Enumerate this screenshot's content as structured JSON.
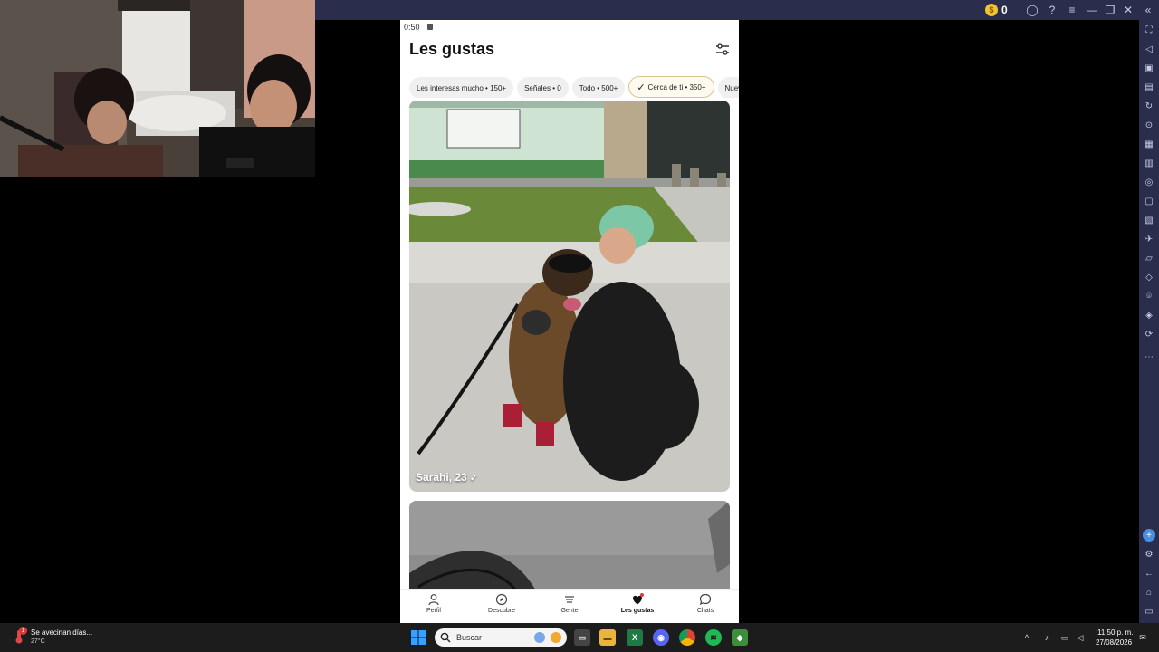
{
  "emulator": {
    "coin_count": "0"
  },
  "phone": {
    "status_time": "0:50",
    "page_title": "Les gustas",
    "chips": [
      {
        "label": "Les interesas mucho • 150+",
        "active": false
      },
      {
        "label": "Señales • 0",
        "active": false
      },
      {
        "label": "Todo • 500+",
        "active": false
      },
      {
        "label": "Cerca de ti • 350+",
        "active": true
      },
      {
        "label": "Nuevos •",
        "active": false
      }
    ],
    "card1": {
      "name": "Sarahi, 23"
    },
    "bottom_nav": [
      {
        "label": "Perfil",
        "icon": "person-icon"
      },
      {
        "label": "Descubre",
        "icon": "compass-icon"
      },
      {
        "label": "Gente",
        "icon": "menu-icon"
      },
      {
        "label": "Les gustas",
        "icon": "heart-icon"
      },
      {
        "label": "Chats",
        "icon": "chat-icon"
      }
    ]
  },
  "taskbar": {
    "weather_title": "Se avecinan días...",
    "weather_temp": "27°C",
    "weather_badge": "1",
    "search_placeholder": "Buscar",
    "clock_time": "11:50 p. m.",
    "clock_date": "27/08/2026"
  },
  "colors": {
    "emulator_chrome": "#2b2d4c",
    "taskbar": "#1c1c1c",
    "active_chip_border": "#d9c48d",
    "notification_dot": "#e23a3a"
  }
}
